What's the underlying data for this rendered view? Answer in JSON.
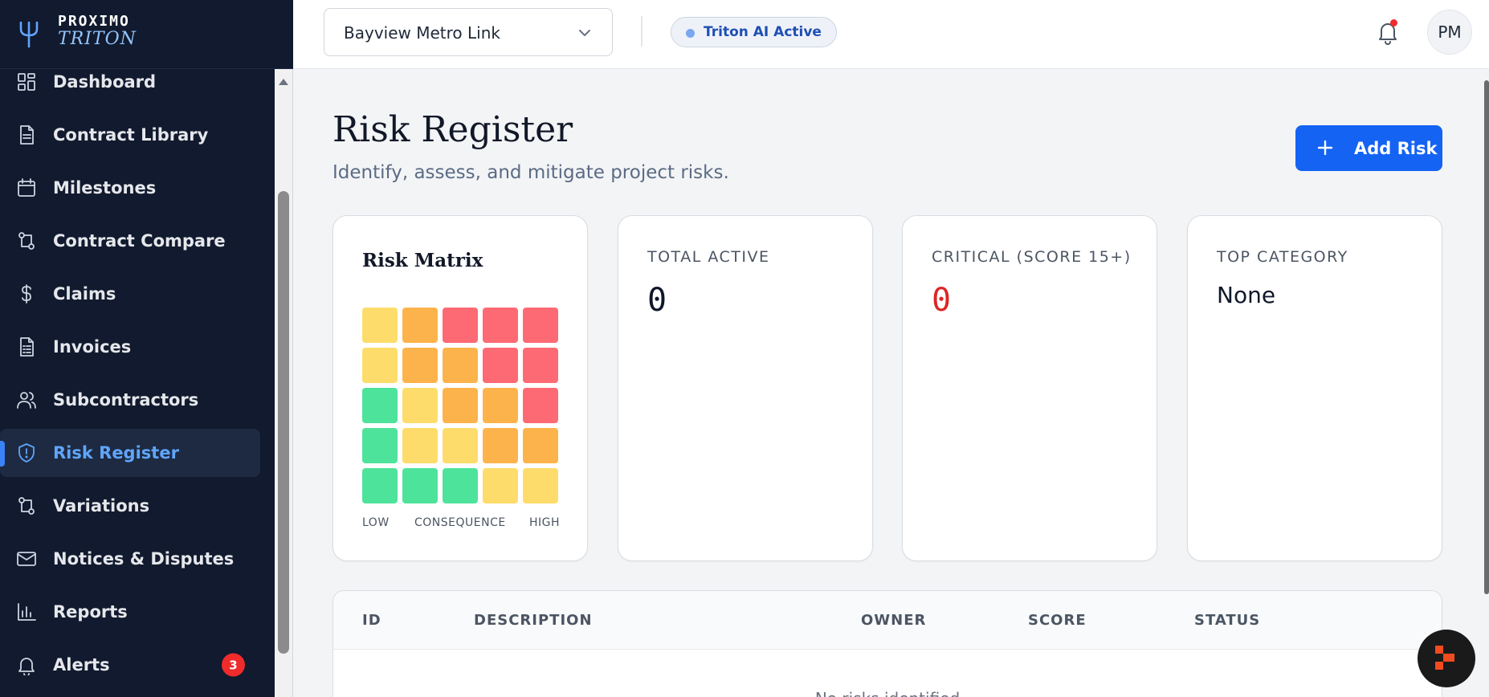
{
  "brand": {
    "name": "PROXIMO",
    "sub": "TRITON"
  },
  "header": {
    "project": "Bayview Metro Link",
    "ai_status": "Triton AI Active",
    "avatar_initials": "PM"
  },
  "sidebar": {
    "items": [
      {
        "label": "Dashboard",
        "icon": "grid-icon"
      },
      {
        "label": "Contract Library",
        "icon": "file-icon"
      },
      {
        "label": "Milestones",
        "icon": "calendar-icon"
      },
      {
        "label": "Contract Compare",
        "icon": "compare-icon"
      },
      {
        "label": "Claims",
        "icon": "dollar-icon"
      },
      {
        "label": "Invoices",
        "icon": "invoice-icon"
      },
      {
        "label": "Subcontractors",
        "icon": "users-icon"
      },
      {
        "label": "Risk Register",
        "icon": "shield-icon",
        "active": true
      },
      {
        "label": "Variations",
        "icon": "branch-icon"
      },
      {
        "label": "Notices & Disputes",
        "icon": "mail-icon"
      },
      {
        "label": "Reports",
        "icon": "bar-chart-icon"
      },
      {
        "label": "Alerts",
        "icon": "bell-icon",
        "badge": "3"
      }
    ]
  },
  "main": {
    "title": "Risk Register",
    "subtitle": "Identify, assess, and mitigate project risks.",
    "add_button": "Add Risk",
    "matrix": {
      "title": "Risk Matrix",
      "axis_low": "LOW",
      "axis_mid": "CONSEQUENCE",
      "axis_high": "HIGH",
      "colors": {
        "green": "#4ee39b",
        "yellow": "#fedc6b",
        "orange": "#fdb34b",
        "red": "#fd6a73"
      },
      "rows": [
        [
          "yellow",
          "orange",
          "red",
          "red",
          "red"
        ],
        [
          "yellow",
          "orange",
          "orange",
          "red",
          "red"
        ],
        [
          "green",
          "yellow",
          "orange",
          "orange",
          "red"
        ],
        [
          "green",
          "yellow",
          "yellow",
          "orange",
          "orange"
        ],
        [
          "green",
          "green",
          "green",
          "yellow",
          "yellow"
        ]
      ]
    },
    "stats": {
      "total_label": "TOTAL ACTIVE",
      "total_value": "0",
      "critical_label": "CRITICAL (SCORE 15+)",
      "critical_value": "0",
      "top_label": "TOP CATEGORY",
      "top_value": "None"
    },
    "table": {
      "columns": [
        "ID",
        "DESCRIPTION",
        "OWNER",
        "SCORE",
        "STATUS"
      ],
      "empty_text": "No risks identified"
    }
  }
}
